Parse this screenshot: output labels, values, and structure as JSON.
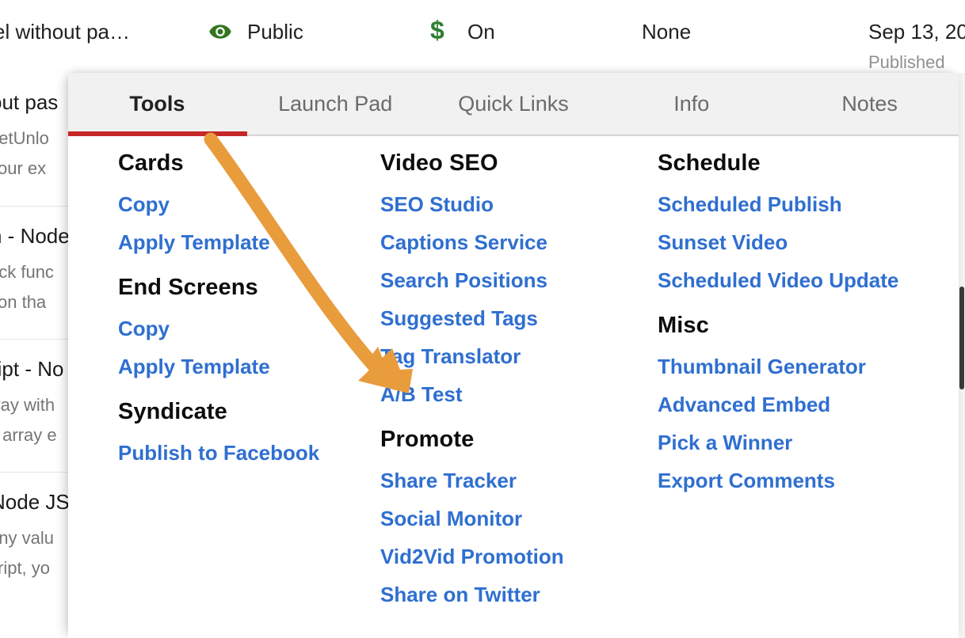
{
  "background": {
    "header_row": {
      "video_title": "el without pa…",
      "visibility_icon": "eye-icon",
      "visibility": "Public",
      "monetization_icon": "dollar-icon",
      "monetization": "On",
      "restrictions": "None",
      "date": "Sep 13, 20",
      "status": "Published"
    },
    "rows": [
      {
        "title": "out pas",
        "desc1": "eetUnlo",
        "desc2": "your ex"
      },
      {
        "title": "n - Node",
        "desc1": "ack func",
        "desc2": "tion tha"
      },
      {
        "title": "ript - No",
        "desc1": "rray with",
        "desc2": "y array e"
      },
      {
        "title": "Node JS",
        "desc1": "any valu",
        "desc2": "cript, yo"
      }
    ]
  },
  "panel": {
    "tabs": [
      {
        "label": "Tools",
        "active": true
      },
      {
        "label": "Launch Pad",
        "active": false
      },
      {
        "label": "Quick Links",
        "active": false
      },
      {
        "label": "Info",
        "active": false
      },
      {
        "label": "Notes",
        "active": false
      }
    ],
    "columns": [
      {
        "groups": [
          {
            "title": "Cards",
            "links": [
              "Copy",
              "Apply Template"
            ]
          },
          {
            "title": "End Screens",
            "links": [
              "Copy",
              "Apply Template"
            ]
          },
          {
            "title": "Syndicate",
            "links": [
              "Publish to Facebook"
            ]
          }
        ]
      },
      {
        "groups": [
          {
            "title": "Video SEO",
            "links": [
              "SEO Studio",
              "Captions Service",
              "Search Positions",
              "Suggested Tags",
              "Tag Translator",
              "A/B Test"
            ]
          },
          {
            "title": "Promote",
            "links": [
              "Share Tracker",
              "Social Monitor",
              "Vid2Vid Promotion",
              "Share on Twitter"
            ]
          }
        ]
      },
      {
        "groups": [
          {
            "title": "Schedule",
            "links": [
              "Scheduled Publish",
              "Sunset Video",
              "Scheduled Video Update"
            ]
          },
          {
            "title": "Misc",
            "links": [
              "Thumbnail Generator",
              "Advanced Embed",
              "Pick a Winner",
              "Export Comments"
            ]
          }
        ]
      }
    ]
  },
  "annotation": {
    "type": "curved-arrow",
    "color": "#E89C3C",
    "points_to": "A/B Test"
  },
  "colors": {
    "accent_red": "#c62828",
    "link_blue": "#2f6fd0",
    "green": "#2E7D32",
    "tab_bg": "#f1f1f1",
    "arrow_orange": "#E89C3C"
  }
}
